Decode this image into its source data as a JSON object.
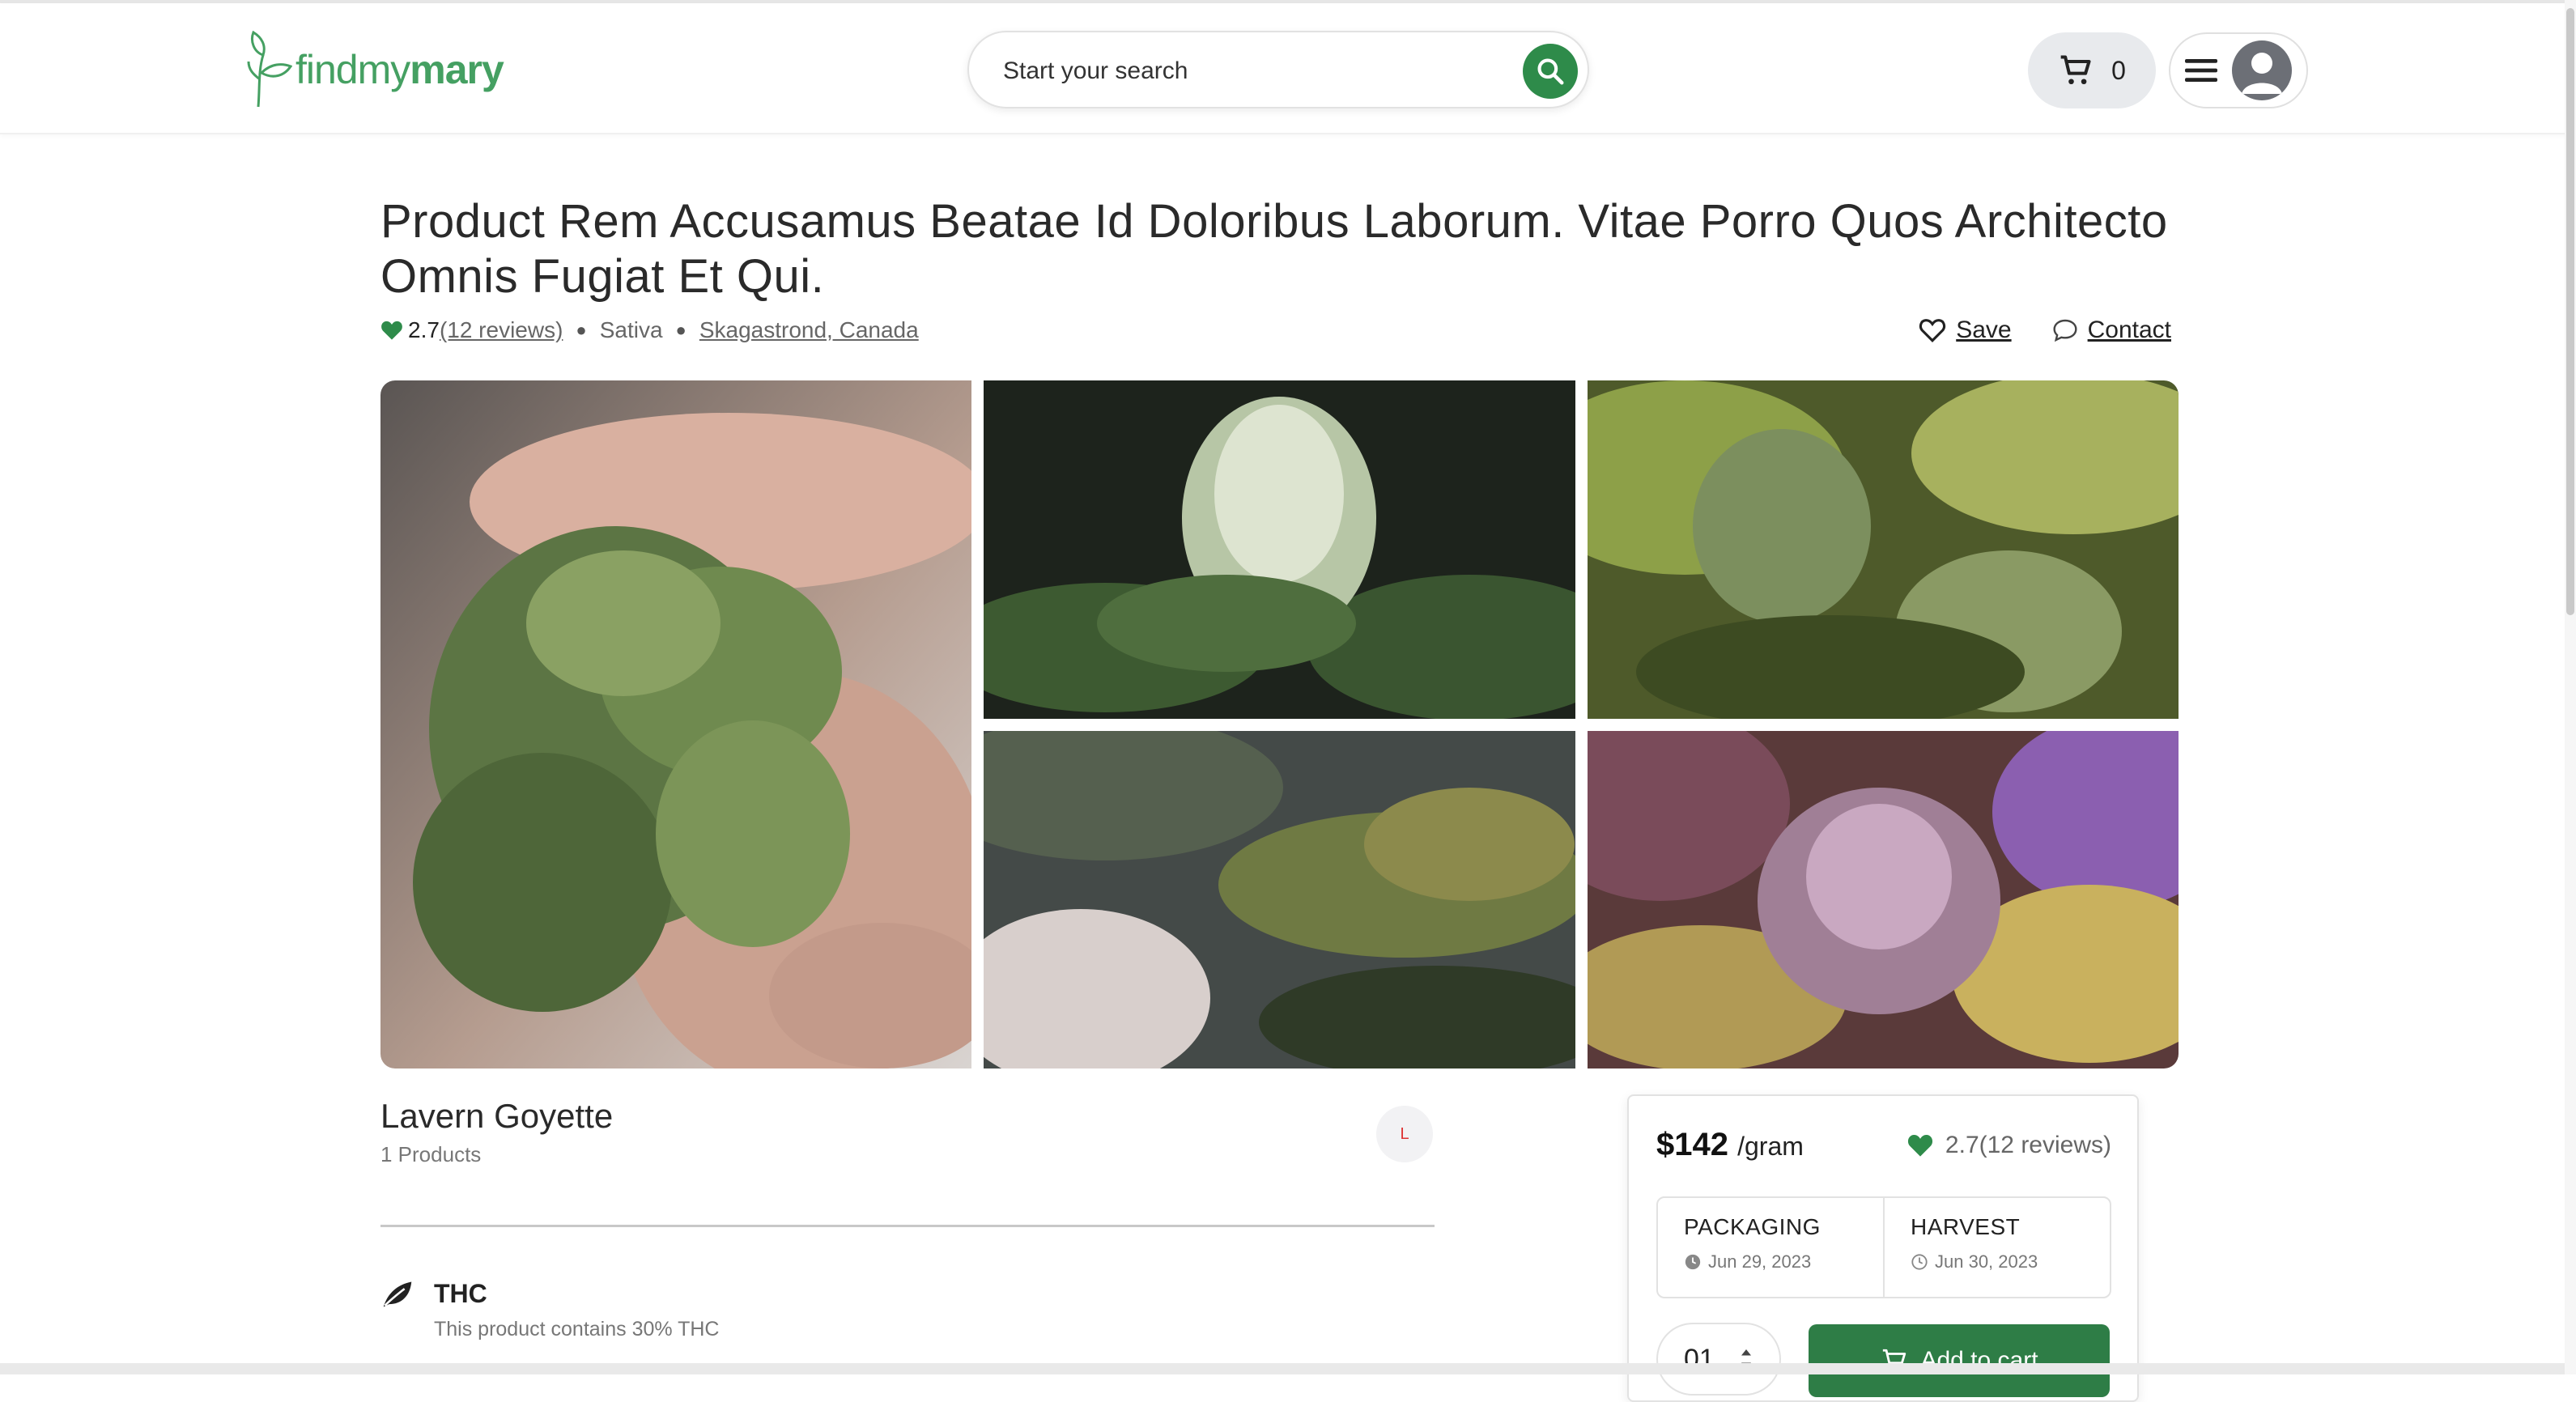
{
  "header": {
    "logo": {
      "light": "findmy",
      "bold": "mary"
    },
    "search": {
      "placeholder": "Start your search"
    },
    "cart": {
      "count": "0"
    }
  },
  "product": {
    "title": "Product Rem Accusamus Beatae Id Doloribus Laborum. Vitae Porro Quos Architecto Omnis Fugiat Et Qui.",
    "rating": "2.7",
    "reviews_link": "(12 reviews)",
    "type": "Sativa",
    "location": "Skagastrond, Canada",
    "save_label": "Save",
    "contact_label": "Contact"
  },
  "seller": {
    "name": "Lavern Goyette",
    "products": "1 Products",
    "badge": "L"
  },
  "thc": {
    "title": "THC",
    "description": "This product contains 30% THC"
  },
  "purchase": {
    "price": "$142",
    "unit": "/gram",
    "rating": "2.7(12 reviews)",
    "packaging_label": "PACKAGING",
    "packaging_date": "Jun 29, 2023",
    "harvest_label": "HARVEST",
    "harvest_date": "Jun 30, 2023",
    "quantity": "01",
    "add_to_cart": "Add to cart"
  },
  "colors": {
    "brand": "#45a062",
    "button": "#2e7d46",
    "heart": "#2e8b4a"
  },
  "icons": [
    "leaf-logo-icon",
    "search-icon",
    "cart-icon",
    "hamburger-icon",
    "user-avatar-icon",
    "heart-icon",
    "chat-bubble-icon",
    "clock-icon",
    "leaf-icon",
    "stepper-icon"
  ]
}
